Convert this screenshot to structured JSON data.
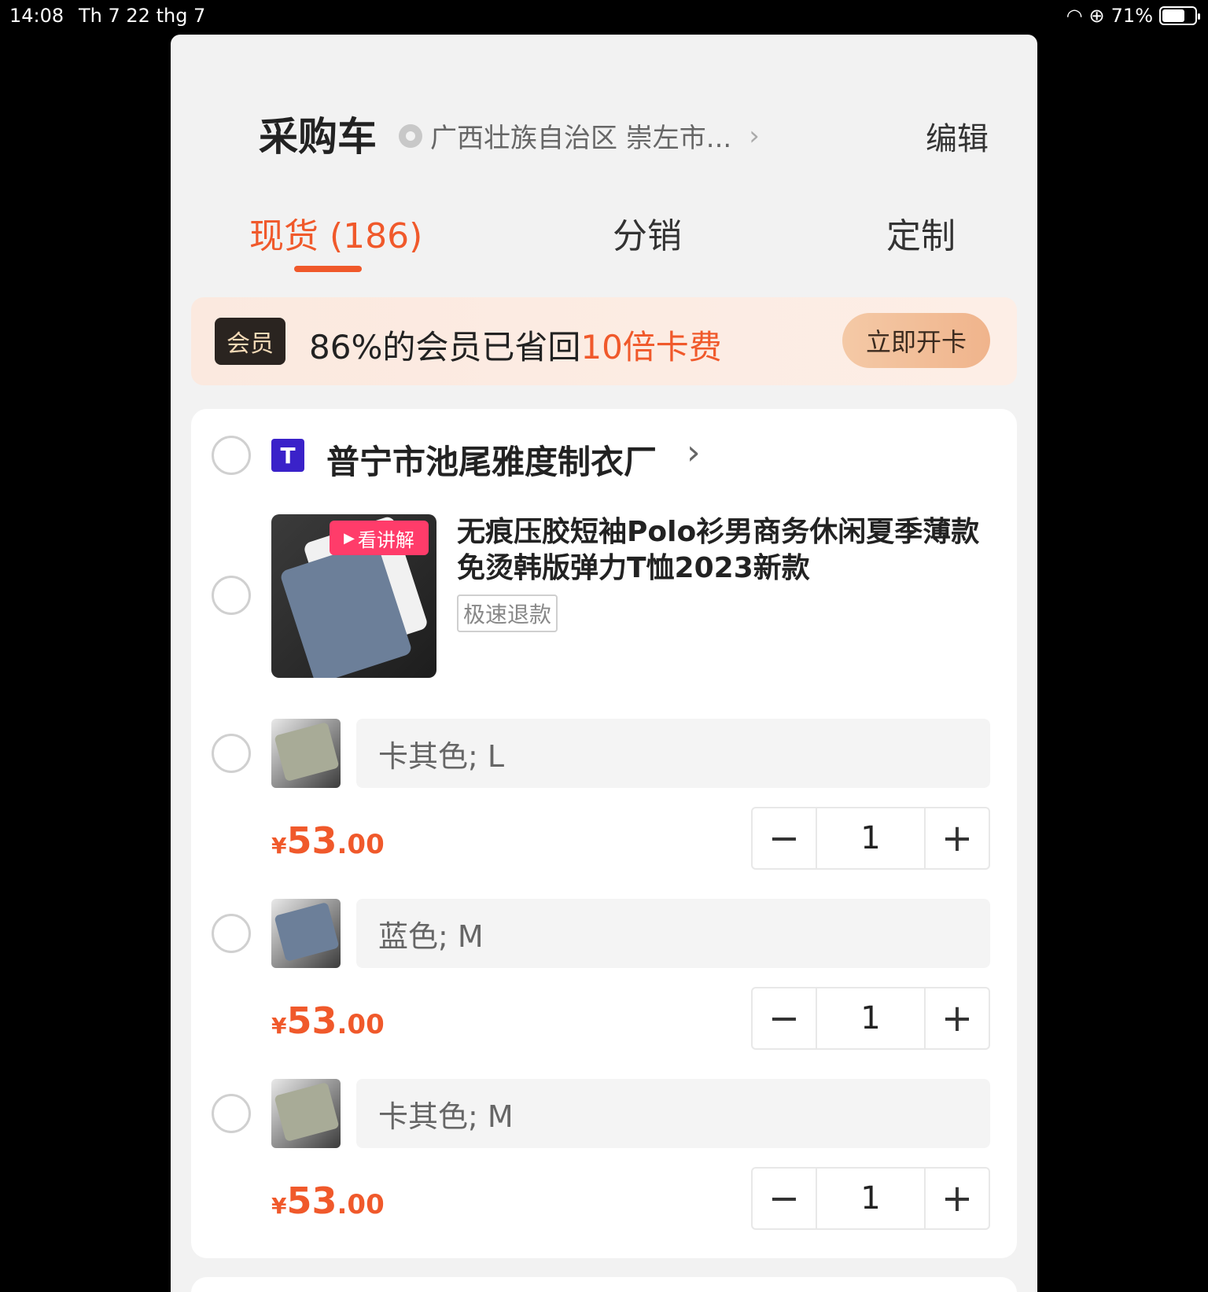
{
  "status": {
    "time": "14:08",
    "date": "Th 7 22 thg 7",
    "battery": "71%",
    "battery_level": 0.71
  },
  "header": {
    "title": "采购车",
    "location": "广西壮族自治区 崇左市...",
    "edit_label": "编辑"
  },
  "tabs": [
    {
      "label": "现货 (186)",
      "active": true
    },
    {
      "label": "分销",
      "active": false
    },
    {
      "label": "定制",
      "active": false
    }
  ],
  "banner": {
    "badge": "会员",
    "text_prefix": "86%的会员已省回",
    "text_highlight": "10倍卡费",
    "button": "立即开卡"
  },
  "shop": {
    "name": "普宁市池尾雅度制衣厂"
  },
  "product": {
    "watch_tag": "看讲解",
    "title": "无痕压胶短袖Polo衫男商务休闲夏季薄款免烫韩版弹力T恤2023新款",
    "tag": "极速退款"
  },
  "variants": [
    {
      "spec": "卡其色; L",
      "yen": "¥",
      "price_int": "53",
      "price_dec": ".00",
      "qty": "1",
      "minus": "−",
      "plus": "+",
      "color": "#a8ab97"
    },
    {
      "spec": "蓝色; M",
      "yen": "¥",
      "price_int": "53",
      "price_dec": ".00",
      "qty": "1",
      "minus": "−",
      "plus": "+",
      "color": "#6c7f99"
    },
    {
      "spec": "卡其色; M",
      "yen": "¥",
      "price_int": "53",
      "price_dec": ".00",
      "qty": "1",
      "minus": "−",
      "plus": "+",
      "color": "#a8ab97"
    }
  ],
  "colors": {
    "accent": "#f0592b",
    "background": "#f2f2f2"
  }
}
